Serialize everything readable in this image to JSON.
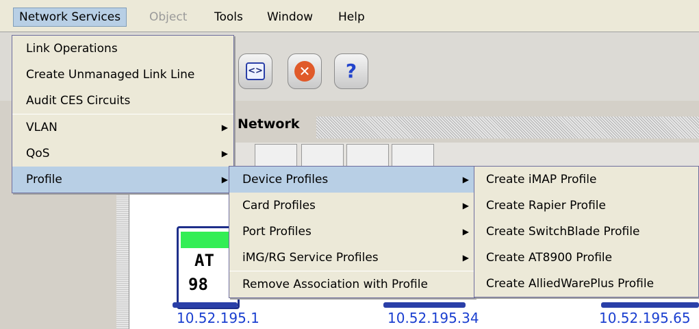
{
  "menubar": {
    "items": [
      {
        "label": "Network Services"
      },
      {
        "label": "Object"
      },
      {
        "label": "Tools"
      },
      {
        "label": "Window"
      },
      {
        "label": "Help"
      }
    ]
  },
  "network_panel": {
    "title": "Network"
  },
  "device": {
    "line1": "AT",
    "line2": "98"
  },
  "ips": [
    "10.52.195.1",
    "10.52.195.34",
    "10.52.195.65"
  ],
  "menu_network_services": {
    "items": [
      {
        "label": "Link Operations"
      },
      {
        "label": "Create Unmanaged Link Line"
      },
      {
        "label": "Audit CES Circuits"
      },
      {
        "label": "VLAN"
      },
      {
        "label": "QoS"
      },
      {
        "label": "Profile"
      }
    ]
  },
  "menu_profile": {
    "items": [
      {
        "label": "Device Profiles"
      },
      {
        "label": "Card Profiles"
      },
      {
        "label": "Port Profiles"
      },
      {
        "label": "iMG/RG Service Profiles"
      },
      {
        "label": "Remove Association with Profile"
      }
    ]
  },
  "menu_device_profiles": {
    "items": [
      {
        "label": "Create iMAP Profile"
      },
      {
        "label": "Create Rapier Profile"
      },
      {
        "label": "Create SwitchBlade Profile"
      },
      {
        "label": "Create AT8900 Profile"
      },
      {
        "label": "Create AlliedWarePlus Profile"
      }
    ]
  },
  "icons": {
    "toolbar": [
      "code-icon",
      "close-icon",
      "help-icon"
    ],
    "submenu_arrow": "chevron-right-icon"
  },
  "colors": {
    "selection": "#b8cfe5",
    "menu_bg": "#ece9d8",
    "ip_text": "#1a3fd0",
    "device_status": "#33ee55"
  }
}
